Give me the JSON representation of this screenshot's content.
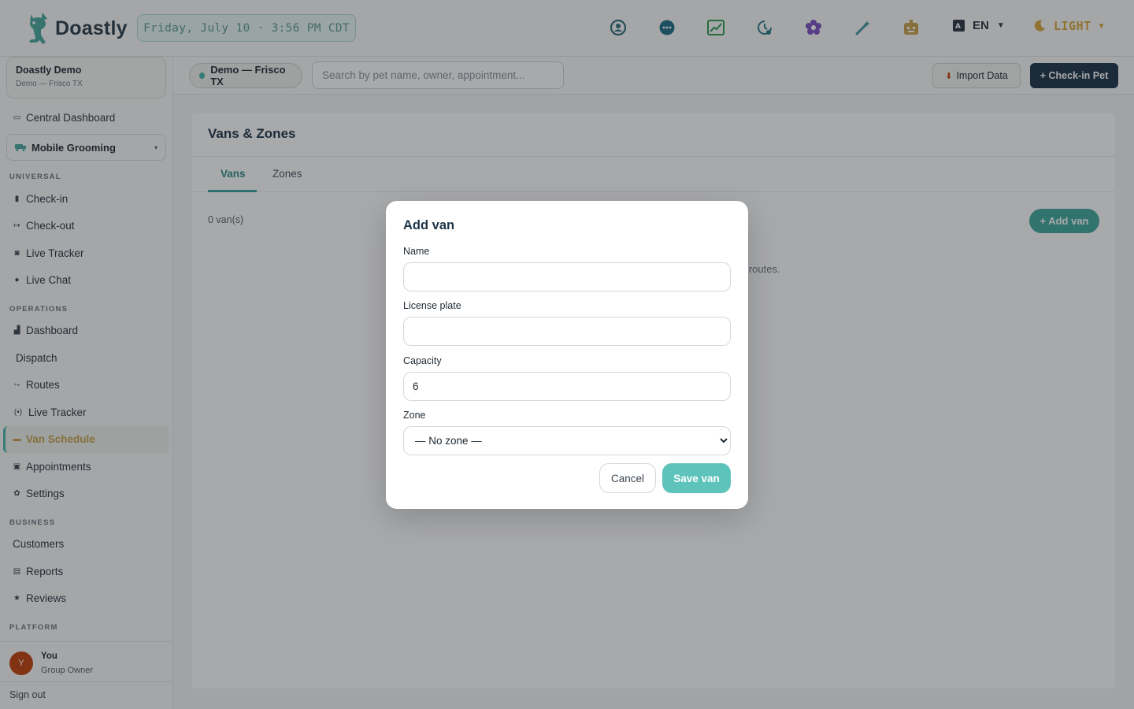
{
  "app": {
    "name": "Doastly"
  },
  "header": {
    "datetime": "Friday, July 10 · 3:56 PM CDT",
    "icons": [
      "support-icon",
      "chat-icon",
      "analytics-icon",
      "clock-icon",
      "flower-icon",
      "magic-wand-icon",
      "robot-icon"
    ],
    "language": "EN",
    "theme": "LIGHT"
  },
  "sidebar": {
    "org_name": "Doastly Demo",
    "org_location": "Demo — Frisco TX",
    "central_dashboard": "Central Dashboard",
    "module_select": "Mobile Grooming",
    "sections": {
      "universal": "UNIVERSAL",
      "operations": "OPERATIONS",
      "business": "BUSINESS",
      "platform": "PLATFORM"
    },
    "universal_items": [
      "Check-in",
      "Check-out",
      "Live Tracker",
      "Live Chat"
    ],
    "operations_items": [
      "Dashboard",
      "Dispatch",
      "Routes",
      "Live Tracker",
      "Van Schedule",
      "Appointments",
      "Settings"
    ],
    "business_items": [
      "Customers",
      "Reports",
      "Reviews"
    ],
    "user": {
      "initial": "Y",
      "name": "You",
      "role": "Group Owner"
    },
    "sign_out": "Sign out"
  },
  "subheader": {
    "location": "Demo — Frisco TX",
    "search_placeholder": "Search by pet name, owner, appointment...",
    "import_label": "Import Data",
    "checkin_label": "+ Check-in Pet"
  },
  "main": {
    "title": "Vans & Zones",
    "tabs": [
      "Vans",
      "Zones"
    ],
    "active_tab": "Vans",
    "count_label": "0 van(s)",
    "add_van_label": "+ Add van",
    "empty_text_visible": "g routes."
  },
  "modal": {
    "title": "Add van",
    "fields": {
      "name": {
        "label": "Name",
        "value": ""
      },
      "plate": {
        "label": "License plate",
        "value": ""
      },
      "capacity": {
        "label": "Capacity",
        "value": "6"
      },
      "zone": {
        "label": "Zone",
        "value": "— No zone —"
      }
    },
    "cancel_label": "Cancel",
    "save_label": "Save van"
  },
  "colors": {
    "brand_teal": "#46b7ac",
    "navy": "#1d3447",
    "save_button": "#5ec4bb",
    "active_nav_text": "#c9a24a",
    "avatar": "#c2410c"
  }
}
